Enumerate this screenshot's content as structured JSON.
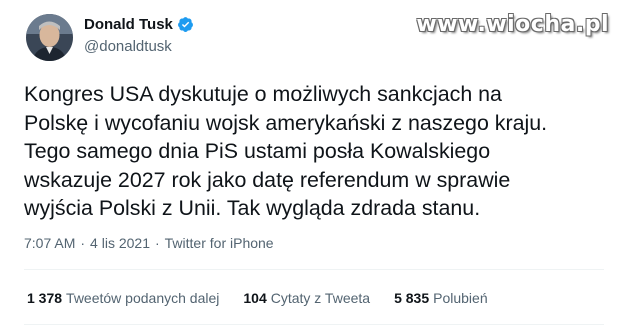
{
  "author": {
    "display_name": "Donald Tusk",
    "handle": "@donaldtusk",
    "verified_color": "#1d9bf0"
  },
  "watermark": "www.wiocha.pl",
  "tweet": {
    "text": "Kongres USA dyskutuje o możliwych sankcjach na\nPolskę i wycofaniu wojsk amerykański z naszego kraju.\nTego samego dnia PiS ustami posła Kowalskiego\nwskazuje 2027 rok jako datę referendum w sprawie\nwyjścia Polski z Unii. Tak wygląda zdrada stanu.",
    "time": "7:07 AM",
    "date": "4 lis 2021",
    "source": "Twitter for iPhone",
    "separator": "·"
  },
  "stats": {
    "retweets_count": "1 378",
    "retweets_label": "Tweetów podanych dalej",
    "quotes_count": "104",
    "quotes_label": "Cytaty z Tweeta",
    "likes_count": "5 835",
    "likes_label": "Polubień"
  }
}
